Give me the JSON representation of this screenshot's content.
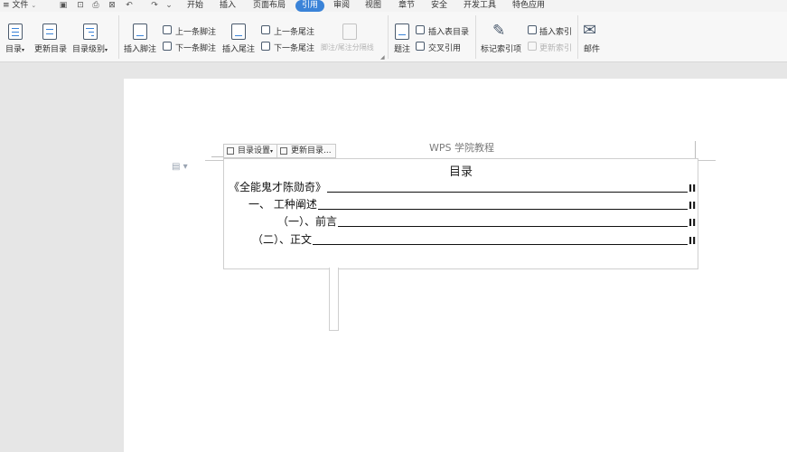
{
  "menubar": {
    "menu_label": "≡ 文件",
    "tabs": [
      "开始",
      "插入",
      "页面布局",
      "引用",
      "审阅",
      "视图",
      "章节",
      "安全",
      "开发工具",
      "特色应用"
    ]
  },
  "ribbon": {
    "toc": "目录",
    "update_toc": "更新目录",
    "toc_level": "目录级别",
    "insert_footnote": "插入脚注",
    "next_footnote_prev": "上一条脚注",
    "next_footnote_next": "下一条脚注",
    "insert_endnote": "插入尾注",
    "endnote_prev": "上一条尾注",
    "endnote_next": "下一条尾注",
    "separator": "脚注/尾注分隔线",
    "caption": "题注",
    "insert_table_toc": "插入表目录",
    "cross_ref": "交叉引用",
    "mark_index": "标记索引项",
    "insert_index": "插入索引",
    "update_index": "更新索引",
    "mail": "邮件"
  },
  "document": {
    "header_text": "WPS 学院教程",
    "toc_settings_label": "目录设置",
    "toc_update_label": "更新目录...",
    "toc_title": "目录",
    "entries": [
      {
        "text": "《全能鬼才陈勋奇》",
        "page": "II"
      },
      {
        "text": "一、   工种阐述",
        "page": "II"
      },
      {
        "text": "（一）、前言",
        "page": "II"
      },
      {
        "text": "（二）、正文",
        "page": "II"
      }
    ]
  },
  "colors": {
    "accent": "#3a83d8",
    "workspace": "#e6e6e6"
  }
}
